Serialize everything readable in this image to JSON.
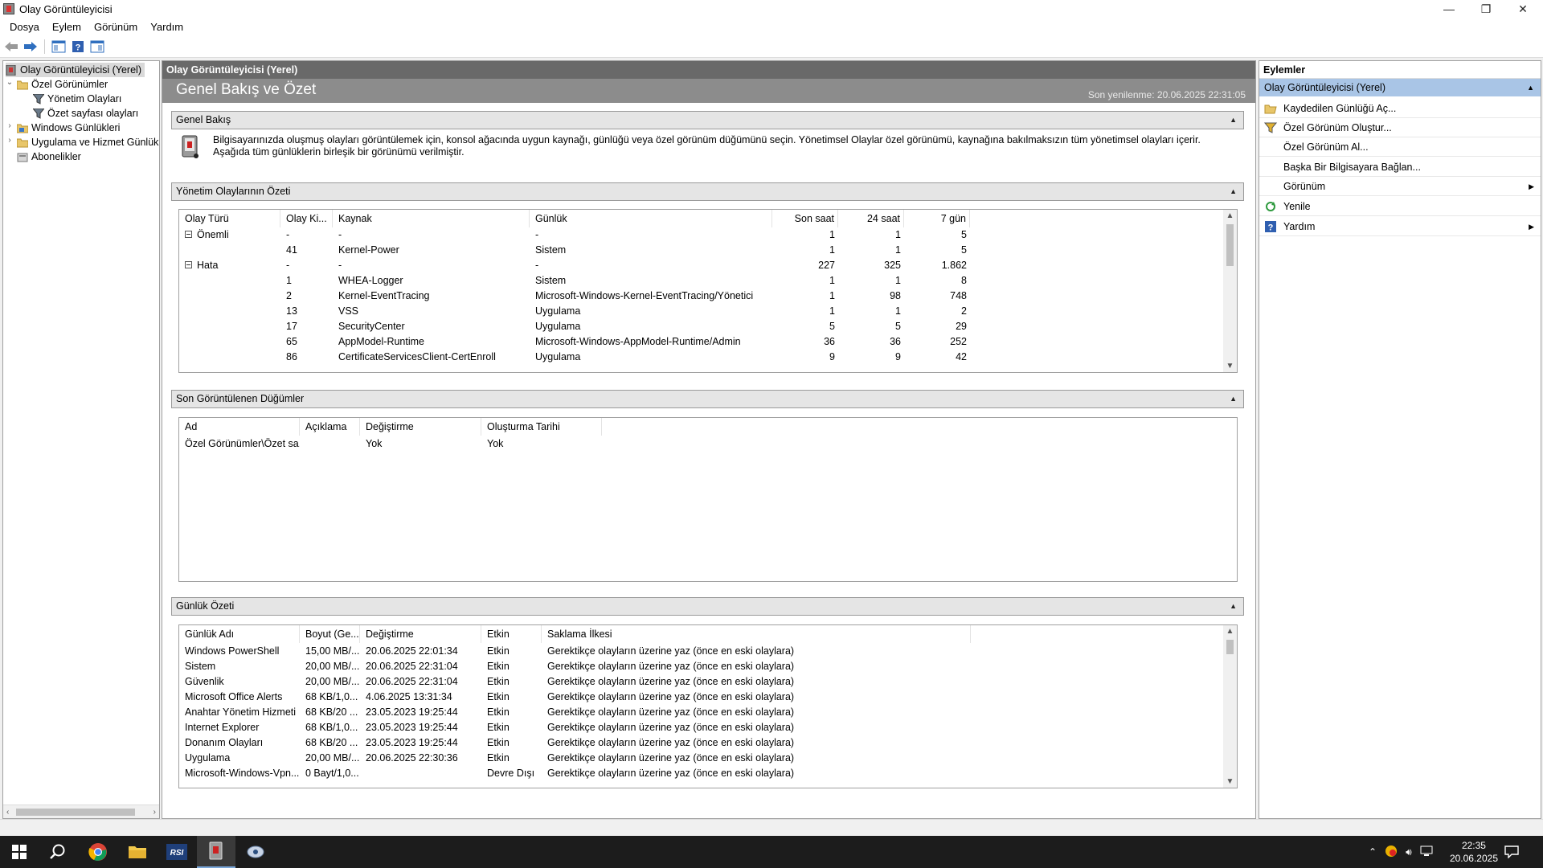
{
  "window": {
    "title": "Olay Görüntüleyicisi",
    "controls": {
      "minimize": "—",
      "restore": "❐",
      "close": "✕"
    }
  },
  "menu": [
    "Dosya",
    "Eylem",
    "Görünüm",
    "Yardım"
  ],
  "tree": {
    "root": "Olay Görüntüleyicisi (Yerel)",
    "custom_views": "Özel Görünümler",
    "admin_events": "Yönetim Olayları",
    "summary_events": "Özet sayfası olayları",
    "windows_logs": "Windows Günlükleri",
    "app_service_logs": "Uygulama ve Hizmet Günlük",
    "subscriptions": "Abonelikler"
  },
  "center": {
    "header": "Olay Görüntüleyicisi (Yerel)",
    "banner_title": "Genel Bakış ve Özet",
    "last_refresh": "Son yenilenme: 20.06.2025 22:31:05",
    "overview": {
      "title": "Genel Bakış",
      "text": "Bilgisayarınızda oluşmuş olayları görüntülemek için, konsol ağacında uygun kaynağı, günlüğü veya özel görünüm düğümünü seçin. Yönetimsel Olaylar özel görünümü, kaynağına bakılmaksızın tüm yönetimsel olayları içerir. Aşağıda tüm günlüklerin birleşik bir görünümü verilmiştir."
    },
    "admin_summary": {
      "title": "Yönetim Olaylarının Özeti",
      "columns": [
        "Olay Türü",
        "Olay Ki...",
        "Kaynak",
        "Günlük",
        "Son saat",
        "24 saat",
        "7 gün"
      ],
      "rows": [
        {
          "type": "Önemli",
          "group": true,
          "id": "-",
          "source": "-",
          "log": "-",
          "h": "1",
          "d": "1",
          "w": "5"
        },
        {
          "type": "",
          "group": false,
          "id": "41",
          "source": "Kernel-Power",
          "log": "Sistem",
          "h": "1",
          "d": "1",
          "w": "5"
        },
        {
          "type": "Hata",
          "group": true,
          "id": "-",
          "source": "-",
          "log": "-",
          "h": "227",
          "d": "325",
          "w": "1.862"
        },
        {
          "type": "",
          "group": false,
          "id": "1",
          "source": "WHEA-Logger",
          "log": "Sistem",
          "h": "1",
          "d": "1",
          "w": "8"
        },
        {
          "type": "",
          "group": false,
          "id": "2",
          "source": "Kernel-EventTracing",
          "log": "Microsoft-Windows-Kernel-EventTracing/Yönetici",
          "h": "1",
          "d": "98",
          "w": "748"
        },
        {
          "type": "",
          "group": false,
          "id": "13",
          "source": "VSS",
          "log": "Uygulama",
          "h": "1",
          "d": "1",
          "w": "2"
        },
        {
          "type": "",
          "group": false,
          "id": "17",
          "source": "SecurityCenter",
          "log": "Uygulama",
          "h": "5",
          "d": "5",
          "w": "29"
        },
        {
          "type": "",
          "group": false,
          "id": "65",
          "source": "AppModel-Runtime",
          "log": "Microsoft-Windows-AppModel-Runtime/Admin",
          "h": "36",
          "d": "36",
          "w": "252"
        },
        {
          "type": "",
          "group": false,
          "id": "86",
          "source": "CertificateServicesClient-CertEnroll",
          "log": "Uygulama",
          "h": "9",
          "d": "9",
          "w": "42"
        }
      ]
    },
    "recent_nodes": {
      "title": "Son Görüntülenen Düğümler",
      "columns": [
        "Ad",
        "Açıklama",
        "Değiştirme",
        "Oluşturma Tarihi"
      ],
      "rows": [
        {
          "name": "Özel Görünümler\\Özet sa...",
          "desc": "",
          "modified": "Yok",
          "created": "Yok"
        }
      ]
    },
    "log_summary": {
      "title": "Günlük Özeti",
      "columns": [
        "Günlük Adı",
        "Boyut (Ge...",
        "Değiştirme",
        "Etkin",
        "Saklama İlkesi"
      ],
      "rows": [
        {
          "name": "Windows PowerShell",
          "size": "15,00 MB/...",
          "modified": "20.06.2025 22:01:34",
          "enabled": "Etkin",
          "policy": "Gerektikçe olayların üzerine yaz (önce en eski olaylara)"
        },
        {
          "name": "Sistem",
          "size": "20,00 MB/...",
          "modified": "20.06.2025 22:31:04",
          "enabled": "Etkin",
          "policy": "Gerektikçe olayların üzerine yaz (önce en eski olaylara)"
        },
        {
          "name": "Güvenlik",
          "size": "20,00 MB/...",
          "modified": "20.06.2025 22:31:04",
          "enabled": "Etkin",
          "policy": "Gerektikçe olayların üzerine yaz (önce en eski olaylara)"
        },
        {
          "name": "Microsoft Office Alerts",
          "size": "68 KB/1,0...",
          "modified": "4.06.2025 13:31:34",
          "enabled": "Etkin",
          "policy": "Gerektikçe olayların üzerine yaz (önce en eski olaylara)"
        },
        {
          "name": "Anahtar Yönetim Hizmeti",
          "size": "68 KB/20 ...",
          "modified": "23.05.2023 19:25:44",
          "enabled": "Etkin",
          "policy": "Gerektikçe olayların üzerine yaz (önce en eski olaylara)"
        },
        {
          "name": "Internet Explorer",
          "size": "68 KB/1,0...",
          "modified": "23.05.2023 19:25:44",
          "enabled": "Etkin",
          "policy": "Gerektikçe olayların üzerine yaz (önce en eski olaylara)"
        },
        {
          "name": "Donanım Olayları",
          "size": "68 KB/20 ...",
          "modified": "23.05.2023 19:25:44",
          "enabled": "Etkin",
          "policy": "Gerektikçe olayların üzerine yaz (önce en eski olaylara)"
        },
        {
          "name": "Uygulama",
          "size": "20,00 MB/...",
          "modified": "20.06.2025 22:30:36",
          "enabled": "Etkin",
          "policy": "Gerektikçe olayların üzerine yaz (önce en eski olaylara)"
        },
        {
          "name": "Microsoft-Windows-Vpn...",
          "size": "0 Bayt/1,0...",
          "modified": "",
          "enabled": "Devre Dışı",
          "policy": "Gerektikçe olayların üzerine yaz (önce en eski olaylara)"
        }
      ]
    }
  },
  "actions": {
    "title": "Eylemler",
    "group": "Olay Görüntüleyicisi (Yerel)",
    "items": [
      {
        "label": "Kaydedilen Günlüğü Aç...",
        "icon": "folder-open-icon",
        "submenu": false
      },
      {
        "label": "Özel Görünüm Oluştur...",
        "icon": "filter-icon",
        "submenu": false
      },
      {
        "label": "Özel Görünüm Al...",
        "icon": "",
        "submenu": false
      },
      {
        "label": "Başka Bir Bilgisayara Bağlan...",
        "icon": "",
        "submenu": false
      },
      {
        "label": "Görünüm",
        "icon": "",
        "submenu": true
      },
      {
        "label": "Yenile",
        "icon": "refresh-icon",
        "submenu": false
      },
      {
        "label": "Yardım",
        "icon": "help-icon",
        "submenu": true
      }
    ]
  },
  "taskbar": {
    "time": "22:35",
    "date": "20.06.2025",
    "apps": [
      "start-icon",
      "search-icon",
      "chrome-icon",
      "file-explorer-icon",
      "rsi-icon",
      "event-viewer-icon",
      "app-icon"
    ]
  },
  "colors": {
    "header_dark": "#696969",
    "banner": "#8c8c8c",
    "section_head": "#e5e5e5",
    "action_group": "#a9c5e6",
    "taskbar": "#1c1c1c"
  }
}
